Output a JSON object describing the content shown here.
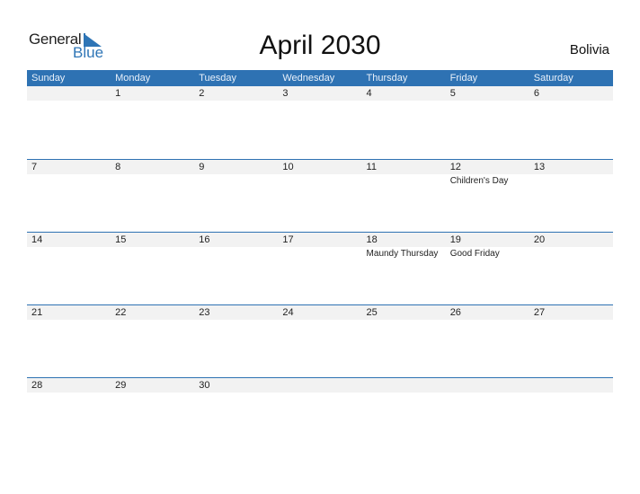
{
  "logo": {
    "general": "General",
    "blue": "Blue",
    "accent_color": "#2e75b6"
  },
  "title": "April 2030",
  "country": "Bolivia",
  "header_color": "#2e72b3",
  "days_of_week": [
    "Sunday",
    "Monday",
    "Tuesday",
    "Wednesday",
    "Thursday",
    "Friday",
    "Saturday"
  ],
  "weeks": [
    [
      {
        "day": ""
      },
      {
        "day": "1"
      },
      {
        "day": "2"
      },
      {
        "day": "3"
      },
      {
        "day": "4"
      },
      {
        "day": "5"
      },
      {
        "day": "6"
      }
    ],
    [
      {
        "day": "7"
      },
      {
        "day": "8"
      },
      {
        "day": "9"
      },
      {
        "day": "10"
      },
      {
        "day": "11"
      },
      {
        "day": "12",
        "holiday": "Children's Day"
      },
      {
        "day": "13"
      }
    ],
    [
      {
        "day": "14"
      },
      {
        "day": "15"
      },
      {
        "day": "16"
      },
      {
        "day": "17"
      },
      {
        "day": "18",
        "holiday": "Maundy Thursday"
      },
      {
        "day": "19",
        "holiday": "Good Friday"
      },
      {
        "day": "20"
      }
    ],
    [
      {
        "day": "21"
      },
      {
        "day": "22"
      },
      {
        "day": "23"
      },
      {
        "day": "24"
      },
      {
        "day": "25"
      },
      {
        "day": "26"
      },
      {
        "day": "27"
      }
    ],
    [
      {
        "day": "28"
      },
      {
        "day": "29"
      },
      {
        "day": "30"
      },
      {
        "day": ""
      },
      {
        "day": ""
      },
      {
        "day": ""
      },
      {
        "day": ""
      }
    ]
  ]
}
